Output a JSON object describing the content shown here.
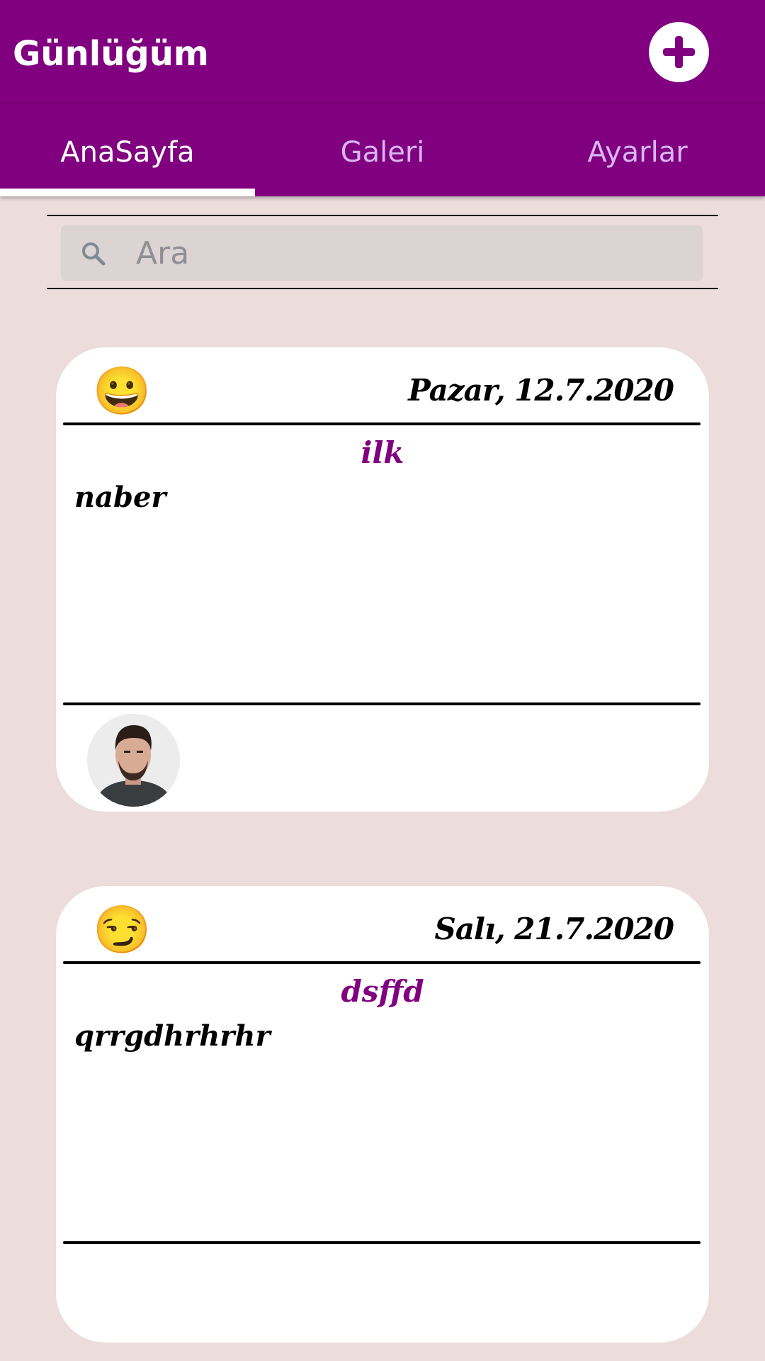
{
  "app": {
    "title": "Günlüğüm"
  },
  "header": {
    "add_icon": "plus-icon"
  },
  "tabs": [
    {
      "label": "AnaSayfa",
      "active": true
    },
    {
      "label": "Galeri",
      "active": false
    },
    {
      "label": "Ayarlar",
      "active": false
    }
  ],
  "search": {
    "placeholder": "Ara",
    "value": "",
    "icon": "search-icon"
  },
  "entries": [
    {
      "mood_emoji": "😀",
      "date": "Pazar, 12.7.2020",
      "title": "ilk",
      "body": "naber",
      "has_photo": true
    },
    {
      "mood_emoji": "😏",
      "date": "Salı, 21.7.2020",
      "title": "dsffd",
      "body": "qrrgdhrhrhr",
      "has_photo": false
    }
  ],
  "colors": {
    "primary": "#800080",
    "background": "#ecdcdc",
    "tab_inactive": "#d7b6f2"
  }
}
